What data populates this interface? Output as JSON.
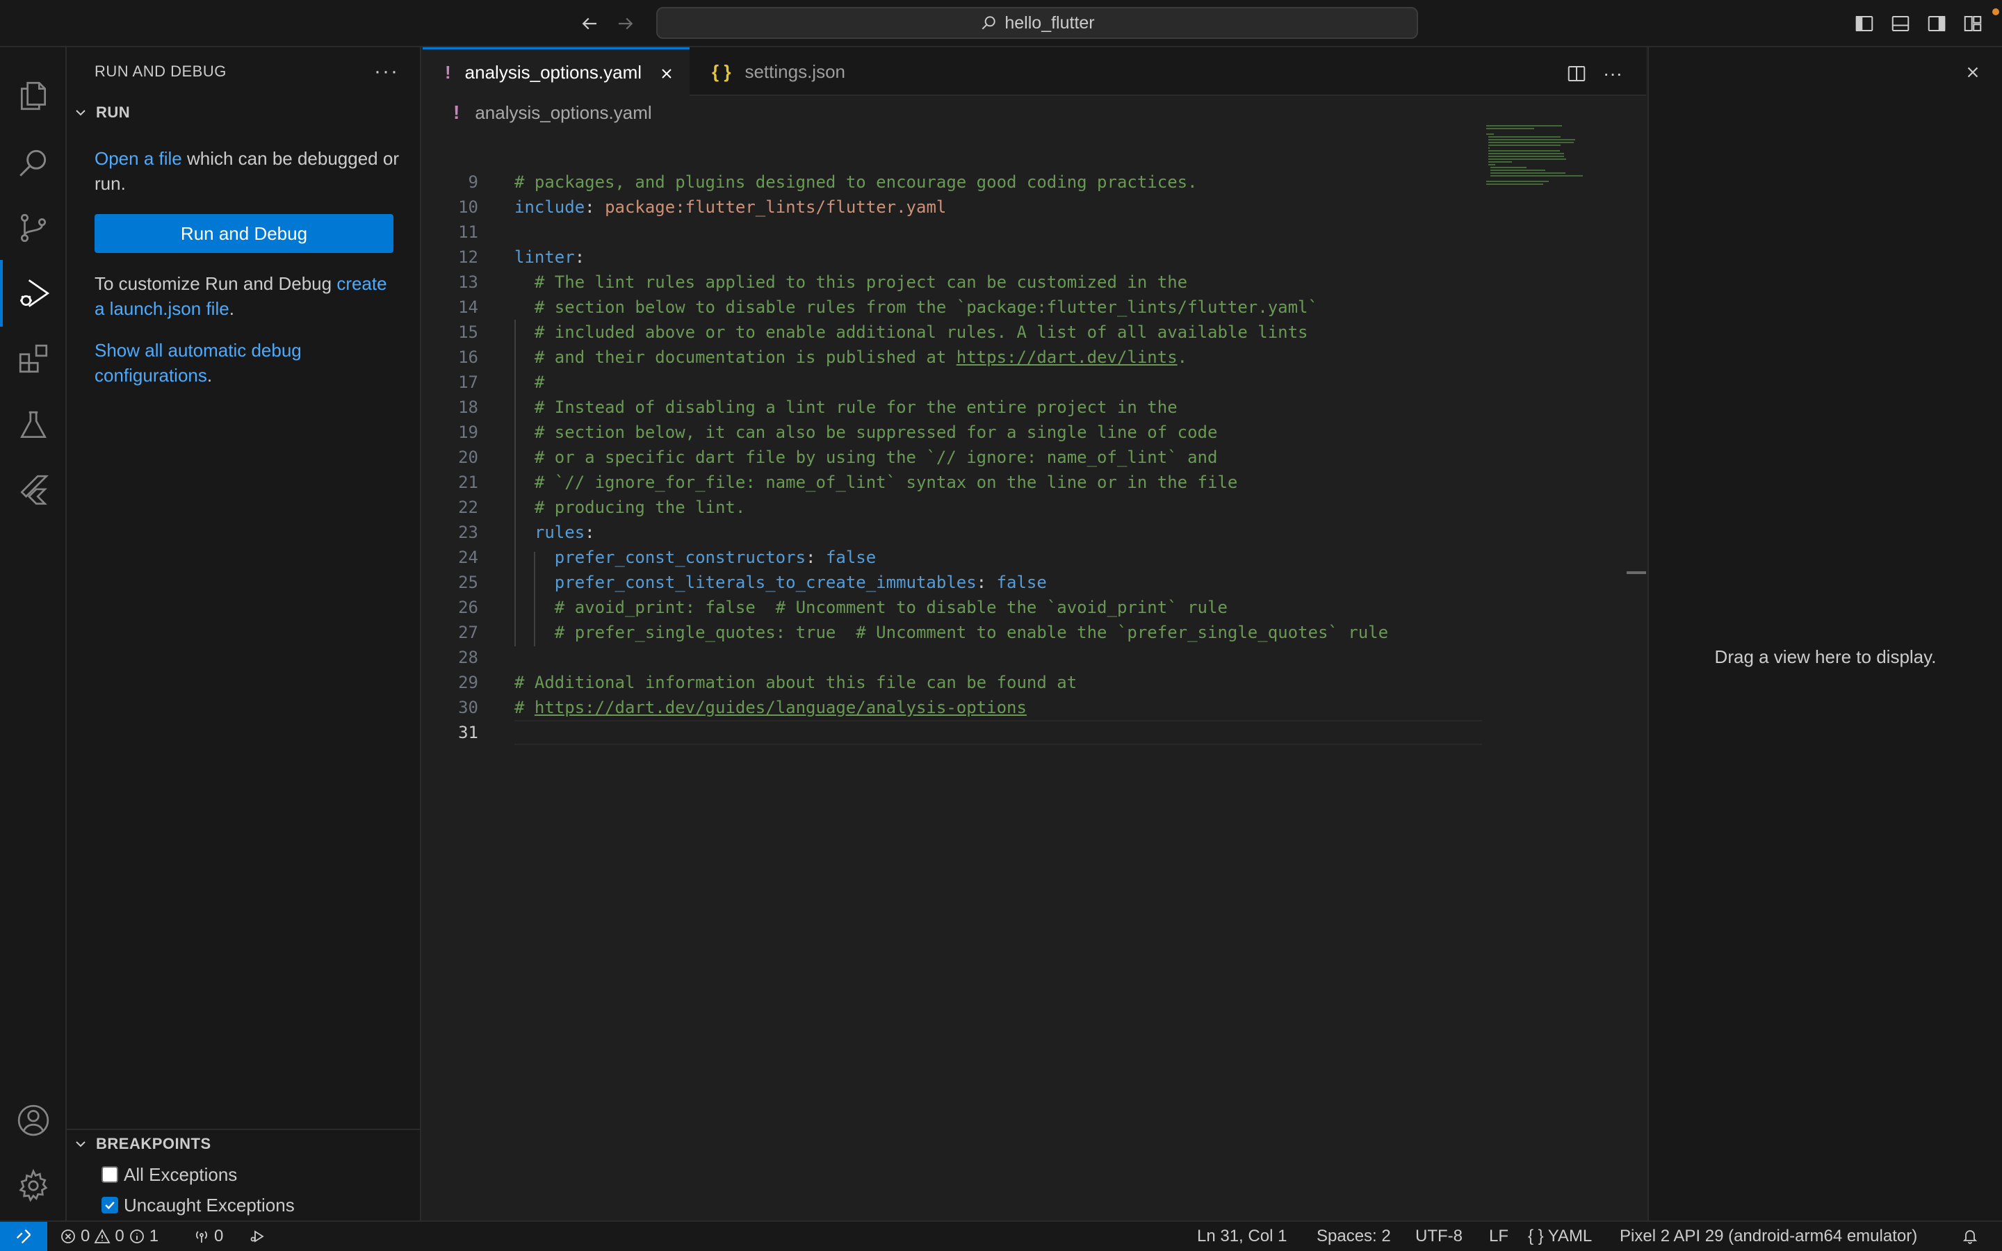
{
  "titlebar": {
    "search_text": "hello_flutter"
  },
  "sidebar": {
    "title": "RUN AND DEBUG",
    "run_section": "RUN",
    "open_file_link": "Open a file",
    "open_file_rest": " which can be debugged or run.",
    "run_button": "Run and Debug",
    "customize_text": "To customize Run and Debug ",
    "launch_link": "create a launch.json file",
    "launch_period": ".",
    "show_all_link": "Show all automatic debug configurations",
    "show_all_period": ".",
    "breakpoints_section": "BREAKPOINTS",
    "breakpoints": [
      {
        "label": "All Exceptions",
        "checked": false
      },
      {
        "label": "Uncaught Exceptions",
        "checked": true
      }
    ]
  },
  "editor": {
    "tabs": [
      {
        "label": "analysis_options.yaml",
        "icon": "!",
        "active": true
      },
      {
        "label": "settings.json",
        "icon": "{ }",
        "active": false
      }
    ],
    "breadcrumb_icon": "!",
    "breadcrumb": "analysis_options.yaml",
    "lines": [
      {
        "n": "9",
        "parts": [
          {
            "t": "# packages, and plugins designed to encourage good coding practices.",
            "c": "cmt"
          }
        ]
      },
      {
        "n": "10",
        "parts": [
          {
            "t": "include",
            "c": "key"
          },
          {
            "t": ": ",
            "c": "punc"
          },
          {
            "t": "package:flutter_lints/flutter.yaml",
            "c": "str"
          }
        ]
      },
      {
        "n": "11",
        "parts": []
      },
      {
        "n": "12",
        "parts": [
          {
            "t": "linter",
            "c": "key"
          },
          {
            "t": ":",
            "c": "punc"
          }
        ]
      },
      {
        "n": "13",
        "parts": [
          {
            "t": "  # The lint rules applied to this project can be customized in the",
            "c": "cmt"
          }
        ]
      },
      {
        "n": "14",
        "parts": [
          {
            "t": "  # section below to disable rules from the `package:flutter_lints/flutter.yaml`",
            "c": "cmt"
          }
        ]
      },
      {
        "n": "15",
        "parts": [
          {
            "t": "  # included above or to enable additional rules. A list of all available lints",
            "c": "cmt"
          }
        ]
      },
      {
        "n": "16",
        "parts": [
          {
            "t": "  # and their documentation is published at ",
            "c": "cmt"
          },
          {
            "t": "https://dart.dev/lints",
            "c": "cmt url"
          },
          {
            "t": ".",
            "c": "cmt"
          }
        ]
      },
      {
        "n": "17",
        "parts": [
          {
            "t": "  #",
            "c": "cmt"
          }
        ]
      },
      {
        "n": "18",
        "parts": [
          {
            "t": "  # Instead of disabling a lint rule for the entire project in the",
            "c": "cmt"
          }
        ]
      },
      {
        "n": "19",
        "parts": [
          {
            "t": "  # section below, it can also be suppressed for a single line of code",
            "c": "cmt"
          }
        ]
      },
      {
        "n": "20",
        "parts": [
          {
            "t": "  # or a specific dart file by using the `// ignore: name_of_lint` and",
            "c": "cmt"
          }
        ]
      },
      {
        "n": "21",
        "parts": [
          {
            "t": "  # `// ignore_for_file: name_of_lint` syntax on the line or in the file",
            "c": "cmt"
          }
        ]
      },
      {
        "n": "22",
        "parts": [
          {
            "t": "  # producing the lint.",
            "c": "cmt"
          }
        ]
      },
      {
        "n": "23",
        "parts": [
          {
            "t": "  ",
            "c": "punc"
          },
          {
            "t": "rules",
            "c": "key"
          },
          {
            "t": ":",
            "c": "punc"
          }
        ]
      },
      {
        "n": "24",
        "parts": [
          {
            "t": "    ",
            "c": "punc"
          },
          {
            "t": "prefer_const_constructors",
            "c": "key"
          },
          {
            "t": ": ",
            "c": "punc"
          },
          {
            "t": "false",
            "c": "bool"
          }
        ]
      },
      {
        "n": "25",
        "parts": [
          {
            "t": "    ",
            "c": "punc"
          },
          {
            "t": "prefer_const_literals_to_create_immutables",
            "c": "key"
          },
          {
            "t": ": ",
            "c": "punc"
          },
          {
            "t": "false",
            "c": "bool"
          }
        ]
      },
      {
        "n": "26",
        "parts": [
          {
            "t": "    # avoid_print: false  # Uncomment to disable the `avoid_print` rule",
            "c": "cmt"
          }
        ]
      },
      {
        "n": "27",
        "parts": [
          {
            "t": "    # prefer_single_quotes: true  # Uncomment to enable the `prefer_single_quotes` rule",
            "c": "cmt"
          }
        ]
      },
      {
        "n": "28",
        "parts": []
      },
      {
        "n": "29",
        "parts": [
          {
            "t": "# Additional information about this file can be found at",
            "c": "cmt"
          }
        ]
      },
      {
        "n": "30",
        "parts": [
          {
            "t": "# ",
            "c": "cmt"
          },
          {
            "t": "https://dart.dev/guides/language/analysis-options",
            "c": "cmt url"
          }
        ]
      },
      {
        "n": "31",
        "parts": [],
        "current": true
      }
    ]
  },
  "aux": {
    "message": "Drag a view here to display."
  },
  "status": {
    "errors": "0",
    "warnings": "0",
    "infos": "1",
    "ports": "0",
    "position": "Ln 31, Col 1",
    "spaces": "Spaces: 2",
    "encoding": "UTF-8",
    "eol": "LF",
    "language_icon": "{ }",
    "language": "YAML",
    "device": "Pixel 2 API 29 (android-arm64 emulator)"
  },
  "colors": {
    "accent": "#0078d4",
    "link": "#4daafc",
    "comment": "#6a9955",
    "key": "#569cd6",
    "string": "#ce9178",
    "yaml_icon": "#c586c0",
    "json_icon": "#e2c541"
  }
}
